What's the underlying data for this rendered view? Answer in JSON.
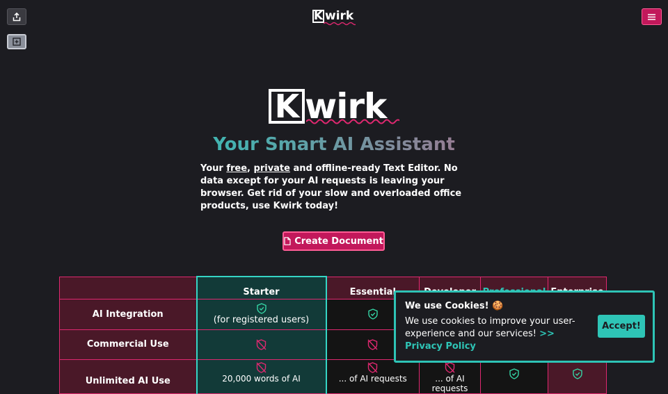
{
  "brand": {
    "name_rest": "wirk",
    "name_initial": "K"
  },
  "colors": {
    "background": "#1c1c21",
    "accent_pink": "#c2185b",
    "accent_teal": "#2ec4b6"
  },
  "toolbar": {
    "share_icon": "share-icon",
    "panel_icon": "add-panel-icon",
    "menu_icon": "hamburger-icon"
  },
  "hero": {
    "title": "Your Smart AI Assistant",
    "desc_1": "Your ",
    "desc_free": "free",
    "desc_2": ", ",
    "desc_private": "private",
    "desc_3": " and offline-ready Text Editor. No data except for your AI requests is leaving your browser. Get rid of your slow and overloaded office products, use Kwirk today!",
    "cta_label": "Create Document"
  },
  "pricing": {
    "columns": [
      "Starter",
      "Essential",
      "Developer",
      "Professional",
      "Enterprise"
    ],
    "rows": [
      {
        "label": "AI Integration",
        "starter_note": "(for registered users)"
      },
      {
        "label": "Commercial Use"
      },
      {
        "label": "Unlimited AI Use",
        "starter_partial": "20,000 words of AI",
        "essential_partial": "... of AI requests",
        "developer_partial": "... of AI requests"
      }
    ]
  },
  "cookie": {
    "title": "We use Cookies! 🍪",
    "text": "We use cookies to improve your user-experience and our services! ",
    "policy_link": ">> Privacy Policy",
    "accept_label": "Accept!"
  }
}
